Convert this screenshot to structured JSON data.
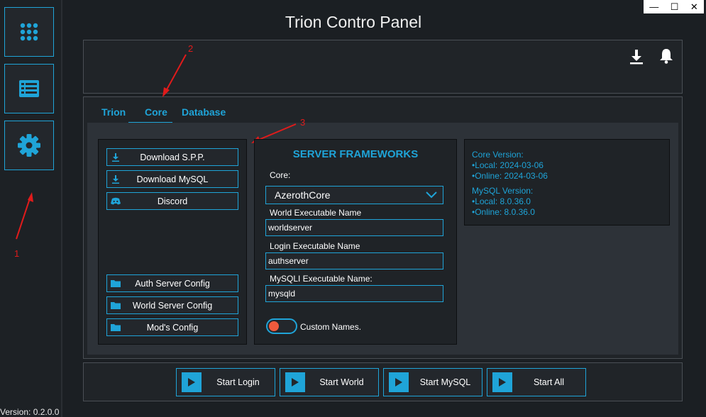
{
  "window": {
    "title": "Trion Contro Panel",
    "minimize": "—",
    "maximize": "☐",
    "close": "✕"
  },
  "sidebar": {
    "items": [
      {
        "icon": "grid-icon"
      },
      {
        "icon": "list-icon"
      },
      {
        "icon": "gear-icon"
      }
    ],
    "version": "Version: 0.2.0.0"
  },
  "header": {
    "icons": [
      "download-icon",
      "bell-icon"
    ]
  },
  "tabs": [
    {
      "label": "Trion"
    },
    {
      "label": "Core"
    },
    {
      "label": "Database"
    }
  ],
  "left_panel": {
    "buttons": [
      {
        "label": "Download S.P.P.",
        "icon": "download-icon"
      },
      {
        "label": "Download MySQL",
        "icon": "download-icon"
      },
      {
        "label": "Discord",
        "icon": "discord-icon"
      },
      {
        "label": "Auth Server Config",
        "icon": "folder-icon"
      },
      {
        "label": "World Server Config",
        "icon": "folder-icon"
      },
      {
        "label": "Mod's Config",
        "icon": "folder-icon"
      }
    ]
  },
  "frameworks": {
    "title": "SERVER FRAMEWORKS",
    "core_label": "Core:",
    "core_value": "AzerothCore",
    "world_label": "World Executable Name",
    "world_value": "worldserver",
    "login_label": "Login Executable Name",
    "login_value": "authserver",
    "mysql_label": "MySQLI Executable Name:",
    "mysql_value": "mysqld",
    "custom_names_label": "Custom Names."
  },
  "version_info": {
    "core_title": "Core Version:",
    "core_local": "•Local: 2024-03-06",
    "core_online": "•Online: 2024-03-06",
    "mysql_title": "MySQL Version:",
    "mysql_local": "•Local: 8.0.36.0",
    "mysql_online": "•Online: 8.0.36.0"
  },
  "footer": {
    "buttons": [
      {
        "label": "Start  Login"
      },
      {
        "label": "Start  World"
      },
      {
        "label": "Start  MySQL"
      },
      {
        "label": "Start All"
      }
    ]
  },
  "annotations": [
    "1",
    "2",
    "3"
  ],
  "colors": {
    "accent": "#1fa4d8",
    "background": "#1b1f23",
    "panel": "#202428",
    "annotation": "#e01b1b",
    "toggle": "#f05a3c"
  }
}
